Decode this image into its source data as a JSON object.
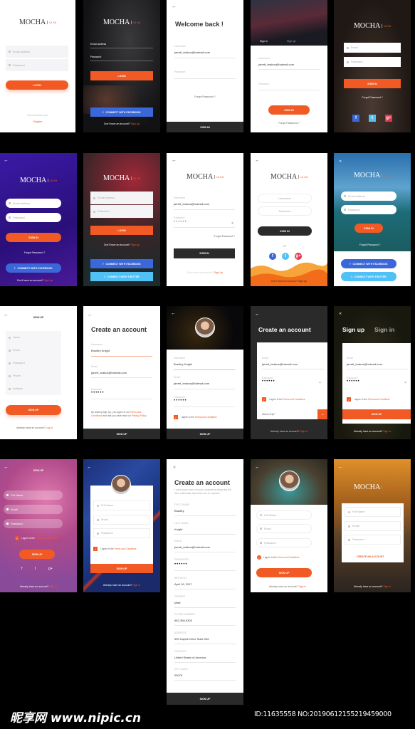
{
  "brand": {
    "name": "MOCHA",
    "kit": "UI Kit"
  },
  "colors": {
    "accent": "#f15a24",
    "facebook": "#3b68d8",
    "twitter": "#4fc1f5",
    "dark": "#2b2b2b"
  },
  "screens": {
    "s1": {
      "email": "Email address",
      "password": "Password",
      "login": "LOGIN",
      "not_member": "Not a member yet?",
      "register": "Register"
    },
    "s2": {
      "email": "Email address",
      "password": "Password",
      "login": "LOGIN",
      "facebook": "CONNECT WITH FACEBOOK",
      "no_account": "Don't have an account?",
      "signup": "Sign Up"
    },
    "s3": {
      "title": "Welcome back !",
      "username_label": "Username",
      "username": "jarrett_brakus@hotmail.com",
      "password_label": "Password",
      "forgot": "Forgot Password ?",
      "signin": "SIGN IN"
    },
    "s4": {
      "tab_signin": "Sign In",
      "tab_signup": "Sign Up",
      "username_label": "Username",
      "username": "jarrett_brakus@hotmail.com",
      "password_label": "Password",
      "signin": "SIGN IN",
      "forgot": "Forgot Password ?"
    },
    "s5": {
      "email": "Email",
      "password": "Password",
      "signin": "SIGN IN",
      "forgot": "Forgot Password ?"
    },
    "s6": {
      "email": "Email address",
      "password": "Password",
      "signin": "SIGN IN",
      "forgot": "Forgot Password ?",
      "facebook": "CONNECT WITH FACEBOOK",
      "no_account": "Don't have an account?",
      "signup": "Sign Up"
    },
    "s7": {
      "email": "Email address",
      "password": "Password",
      "login": "LOGIN",
      "no_account": "Don't have an account?",
      "signup": "Sign Up",
      "facebook": "CONNECT WITH FACEBOOK",
      "twitter": "CONNECT WITH TWITTER"
    },
    "s8": {
      "username_label": "Username",
      "username": "jarrett_brakus@hotmail.com",
      "password_label": "Password",
      "password": "••••••",
      "forgot": "Forgot Password ?",
      "signin": "SIGN IN",
      "no_account": "Don't have an account?",
      "signup": "Sign Up"
    },
    "s9": {
      "username": "Username",
      "password": "Password",
      "signin": "SIGN IN",
      "or": "OR",
      "no_account": "Don't have an account?",
      "signup": "Sign Up"
    },
    "s10": {
      "email": "Email address",
      "password": "Password",
      "signin": "SIGN IN",
      "forgot": "Forgot Password ?",
      "facebook": "CONNECT WITH FACEBOOK",
      "twitter": "CONNECT WITH TWITTER"
    },
    "s11": {
      "title": "SIGN UP",
      "fields": [
        "Name",
        "Email",
        "Password",
        "Phone",
        "Address"
      ],
      "signup": "SIGN UP",
      "have": "Already have an account?",
      "login": "Log In"
    },
    "s12": {
      "title": "Create an account",
      "username_label": "Username",
      "username": "Bradley Knight",
      "email_label": "Email",
      "email": "jarrett_brakus@hotmail.com",
      "password_label": "Password",
      "password": "••••••",
      "terms_pre": "By clicking Sign Up, you agree to our",
      "terms": "Terms and Conditions",
      "terms_mid": "and that you have read our",
      "privacy": "Privacy Policy",
      "signup": "SIGN UP"
    },
    "s13": {
      "username_label": "Username",
      "username": "Bradley Knight",
      "email_label": "Email",
      "email": "jarrett_brakus@hotmail.com",
      "password_label": "Password",
      "password": "••••••",
      "agree": "I agree to the",
      "terms": "Terms and Conditions",
      "signup": "SIGN UP"
    },
    "s14": {
      "title": "Create an account",
      "email_label": "Email",
      "email": "jarrett_brakus@hotmail.com",
      "password_label": "Password",
      "password": "••••••",
      "agree": "I agree to the",
      "terms": "Terms and Conditions",
      "need_help": "Need Help?",
      "have": "Already have an account?",
      "signin": "Sign in"
    },
    "s15": {
      "tab_signup": "Sign up",
      "tab_signin": "Sign in",
      "email_label": "Email",
      "email": "jarrett_brakus@hotmail.com",
      "password_label": "Password",
      "password": "••••••",
      "agree": "I agree to the",
      "terms": "Terms and Conditions",
      "signup": "SIGN UP",
      "have": "Already have an account?",
      "signin": "Sign in"
    },
    "s16": {
      "title": "SIGN UP",
      "fields": [
        "Full Name",
        "Email",
        "Password"
      ],
      "agree": "I agree to the",
      "terms": "Terms and Conditions",
      "signup": "SIGN UP",
      "have": "Already have an account?",
      "signin": "Sign in"
    },
    "s17": {
      "fields": [
        "Full Name",
        "Email",
        "Password"
      ],
      "agree": "I agree to the",
      "terms": "Terms and Conditions",
      "signup": "SIGN UP",
      "have": "Already have an account?",
      "signin": "Sign in"
    },
    "s18": {
      "title": "Create an account",
      "desc": "Lorem ipsum dolor sit amet, consectetur adipiscing elit. Nam malesuada imperdiet eros at vulputate",
      "fields": [
        {
          "label": "FIRST NAME",
          "value": "Bradley"
        },
        {
          "label": "LAST NAME",
          "value": "Knight"
        },
        {
          "label": "EMAIL",
          "value": "jarrett_brakus@hotmail.com"
        },
        {
          "label": "PASSWORD",
          "value": "••••••"
        },
        {
          "label": "BIRTHDAY",
          "value": "April 16, 2017"
        },
        {
          "label": "GENDER",
          "value": "Male"
        },
        {
          "label": "PHONE NUMBER",
          "value": "982-366-5303"
        },
        {
          "label": "ADDRESS",
          "value": "990 Kaylee Drive Suite 926"
        },
        {
          "label": "COUNTRY",
          "value": "United States of America"
        },
        {
          "label": "ZIP CODES",
          "value": "09078"
        }
      ],
      "signup": "SIGN UP"
    },
    "s19": {
      "fields": [
        "Full Name",
        "Email",
        "Password"
      ],
      "agree": "I agree to the",
      "terms": "Terms and Conditions",
      "signup": "SIGN UP",
      "have": "Already have an account?",
      "signin": "Sign in"
    },
    "s20": {
      "fields": [
        "Full Name",
        "Email",
        "Password"
      ],
      "create": "CREATE AN ACCOUNT",
      "have": "Already have an account?",
      "signin": "Sign in"
    }
  },
  "watermark": {
    "logo": "昵享网",
    "url": "www.nipic.cn",
    "id": "ID:11635558 NO:20190612155219459000"
  }
}
